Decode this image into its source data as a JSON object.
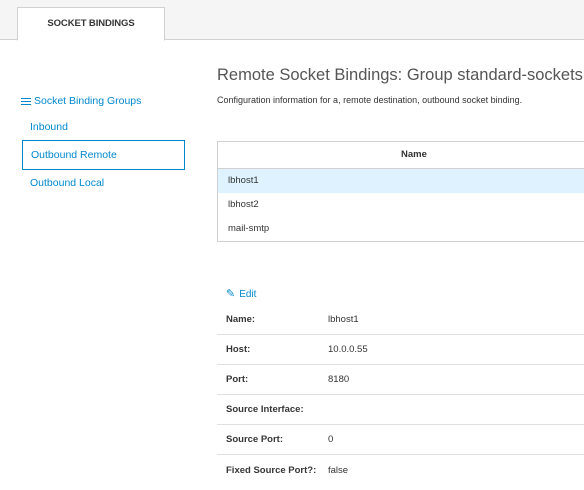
{
  "tabs": [
    {
      "label": "SOCKET BINDINGS"
    }
  ],
  "sidebar": {
    "heading": "Socket Binding Groups",
    "heading_icon": "list-icon",
    "items": [
      {
        "label": "Inbound"
      },
      {
        "label": "Outbound Remote",
        "active": true
      },
      {
        "label": "Outbound Local"
      }
    ]
  },
  "main": {
    "title": "Remote Socket Bindings: Group standard-sockets",
    "description": "Configuration information for a, remote destination, outbound socket binding.",
    "table": {
      "header": "Name",
      "rows": [
        "lbhost1",
        "lbhost2",
        "mail-smtp"
      ],
      "selected_row": "lbhost1"
    },
    "edit_label": "Edit",
    "edit_icon": "edit-icon",
    "properties": [
      {
        "name": "Name:",
        "value": "lbhost1"
      },
      {
        "name": "Host:",
        "value": "10.0.0.55"
      },
      {
        "name": "Port:",
        "value": "8180"
      },
      {
        "name": "Source Interface:",
        "value": ""
      },
      {
        "name": "Source Port:",
        "value": "0"
      },
      {
        "name": "Fixed Source Port?:",
        "value": "false"
      }
    ]
  },
  "colors": {
    "accent": "#0088ce",
    "selected_row": "#def3ff"
  }
}
